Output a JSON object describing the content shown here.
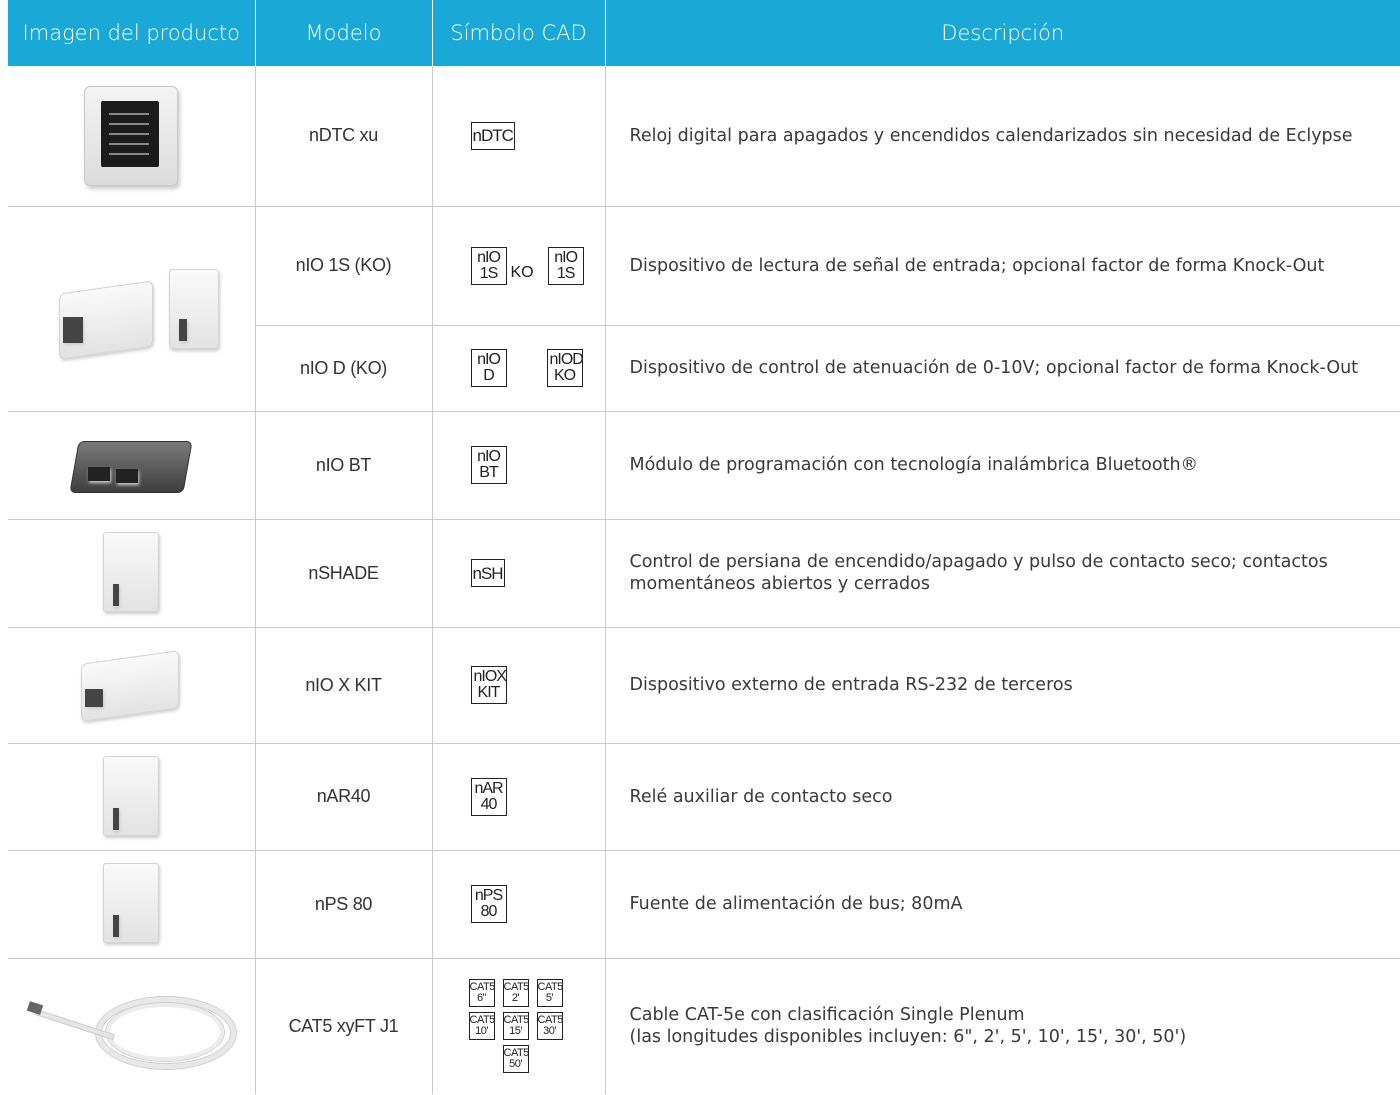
{
  "header": {
    "col_image": "Imagen del producto",
    "col_model": "Modelo",
    "col_cad": "Símbolo CAD",
    "col_desc": "Descripción"
  },
  "rows": [
    {
      "model": "nDTC xu",
      "cad": [
        "nDTC"
      ],
      "desc": "Reloj digital para apagados y encendidos calendarizados sin necesidad de Eclypse"
    },
    {
      "model": "nIO 1S (KO)",
      "cad": [
        "nIO 1S",
        "KO",
        "nIO 1S"
      ],
      "desc": "Dispositivo de lectura de señal de entrada; opcional factor de forma Knock-Out"
    },
    {
      "model": "nIO D (KO)",
      "cad": [
        "nIO D",
        "nIOD KO"
      ],
      "desc": "Dispositivo de control de atenuación de 0-10V; opcional factor de forma Knock-Out"
    },
    {
      "model": "nIO BT",
      "cad": [
        "nIO BT"
      ],
      "desc": "Módulo de programación con tecnología inalámbrica Bluetooth®"
    },
    {
      "model": "nSHADE",
      "cad": [
        "nSH"
      ],
      "desc_line1": "Control de persiana de encendido/apagado y pulso de contacto seco; contactos",
      "desc_line2": "momentáneos abiertos y cerrados"
    },
    {
      "model": "nIO X KIT",
      "cad": [
        "nIOX KIT"
      ],
      "desc": "Dispositivo externo de entrada RS-232 de terceros"
    },
    {
      "model": "nAR40",
      "cad": [
        "nAR 40"
      ],
      "desc": "Relé auxiliar de contacto seco"
    },
    {
      "model": "nPS 80",
      "cad": [
        "nPS 80"
      ],
      "desc": "Fuente de alimentación de bus; 80mA"
    },
    {
      "model": "CAT5 xyFT J1",
      "cad": [
        "CAT5 6\"",
        "CAT5 2'",
        "CAT5 5'",
        "CAT5 10'",
        "CAT5 15'",
        "CAT5 30'",
        "CAT5 50'"
      ],
      "desc_line1": "Cable CAT-5e con clasificación Single Plenum",
      "desc_line2": "(las longitudes disponibles incluyen: 6\", 2', 5', 10', 15', 30', 50')"
    }
  ],
  "cad_symbols": {
    "ndtc": "nDTC",
    "nio1s_top": "nIO",
    "nio1s_bot": "1S",
    "ko": "KO",
    "niod_top": "nIO",
    "niod_bot": "D",
    "niodko_top": "nIOD",
    "niodko_bot": "KO",
    "niobt_top": "nIO",
    "niobt_bot": "BT",
    "nsh": "nSH",
    "niox_top": "nIOX",
    "niox_bot": "KIT",
    "nar_top": "nAR",
    "nar_bot": "40",
    "nps_top": "nPS",
    "nps_bot": "80",
    "cat": "CAT5",
    "cat_lengths": [
      "6\"",
      "2'",
      "5'",
      "10'",
      "15'",
      "30'",
      "50'"
    ]
  },
  "colors": {
    "header_bg": "#1aa9d6",
    "header_text": "#ffffff",
    "rule": "#c9c9c9"
  }
}
